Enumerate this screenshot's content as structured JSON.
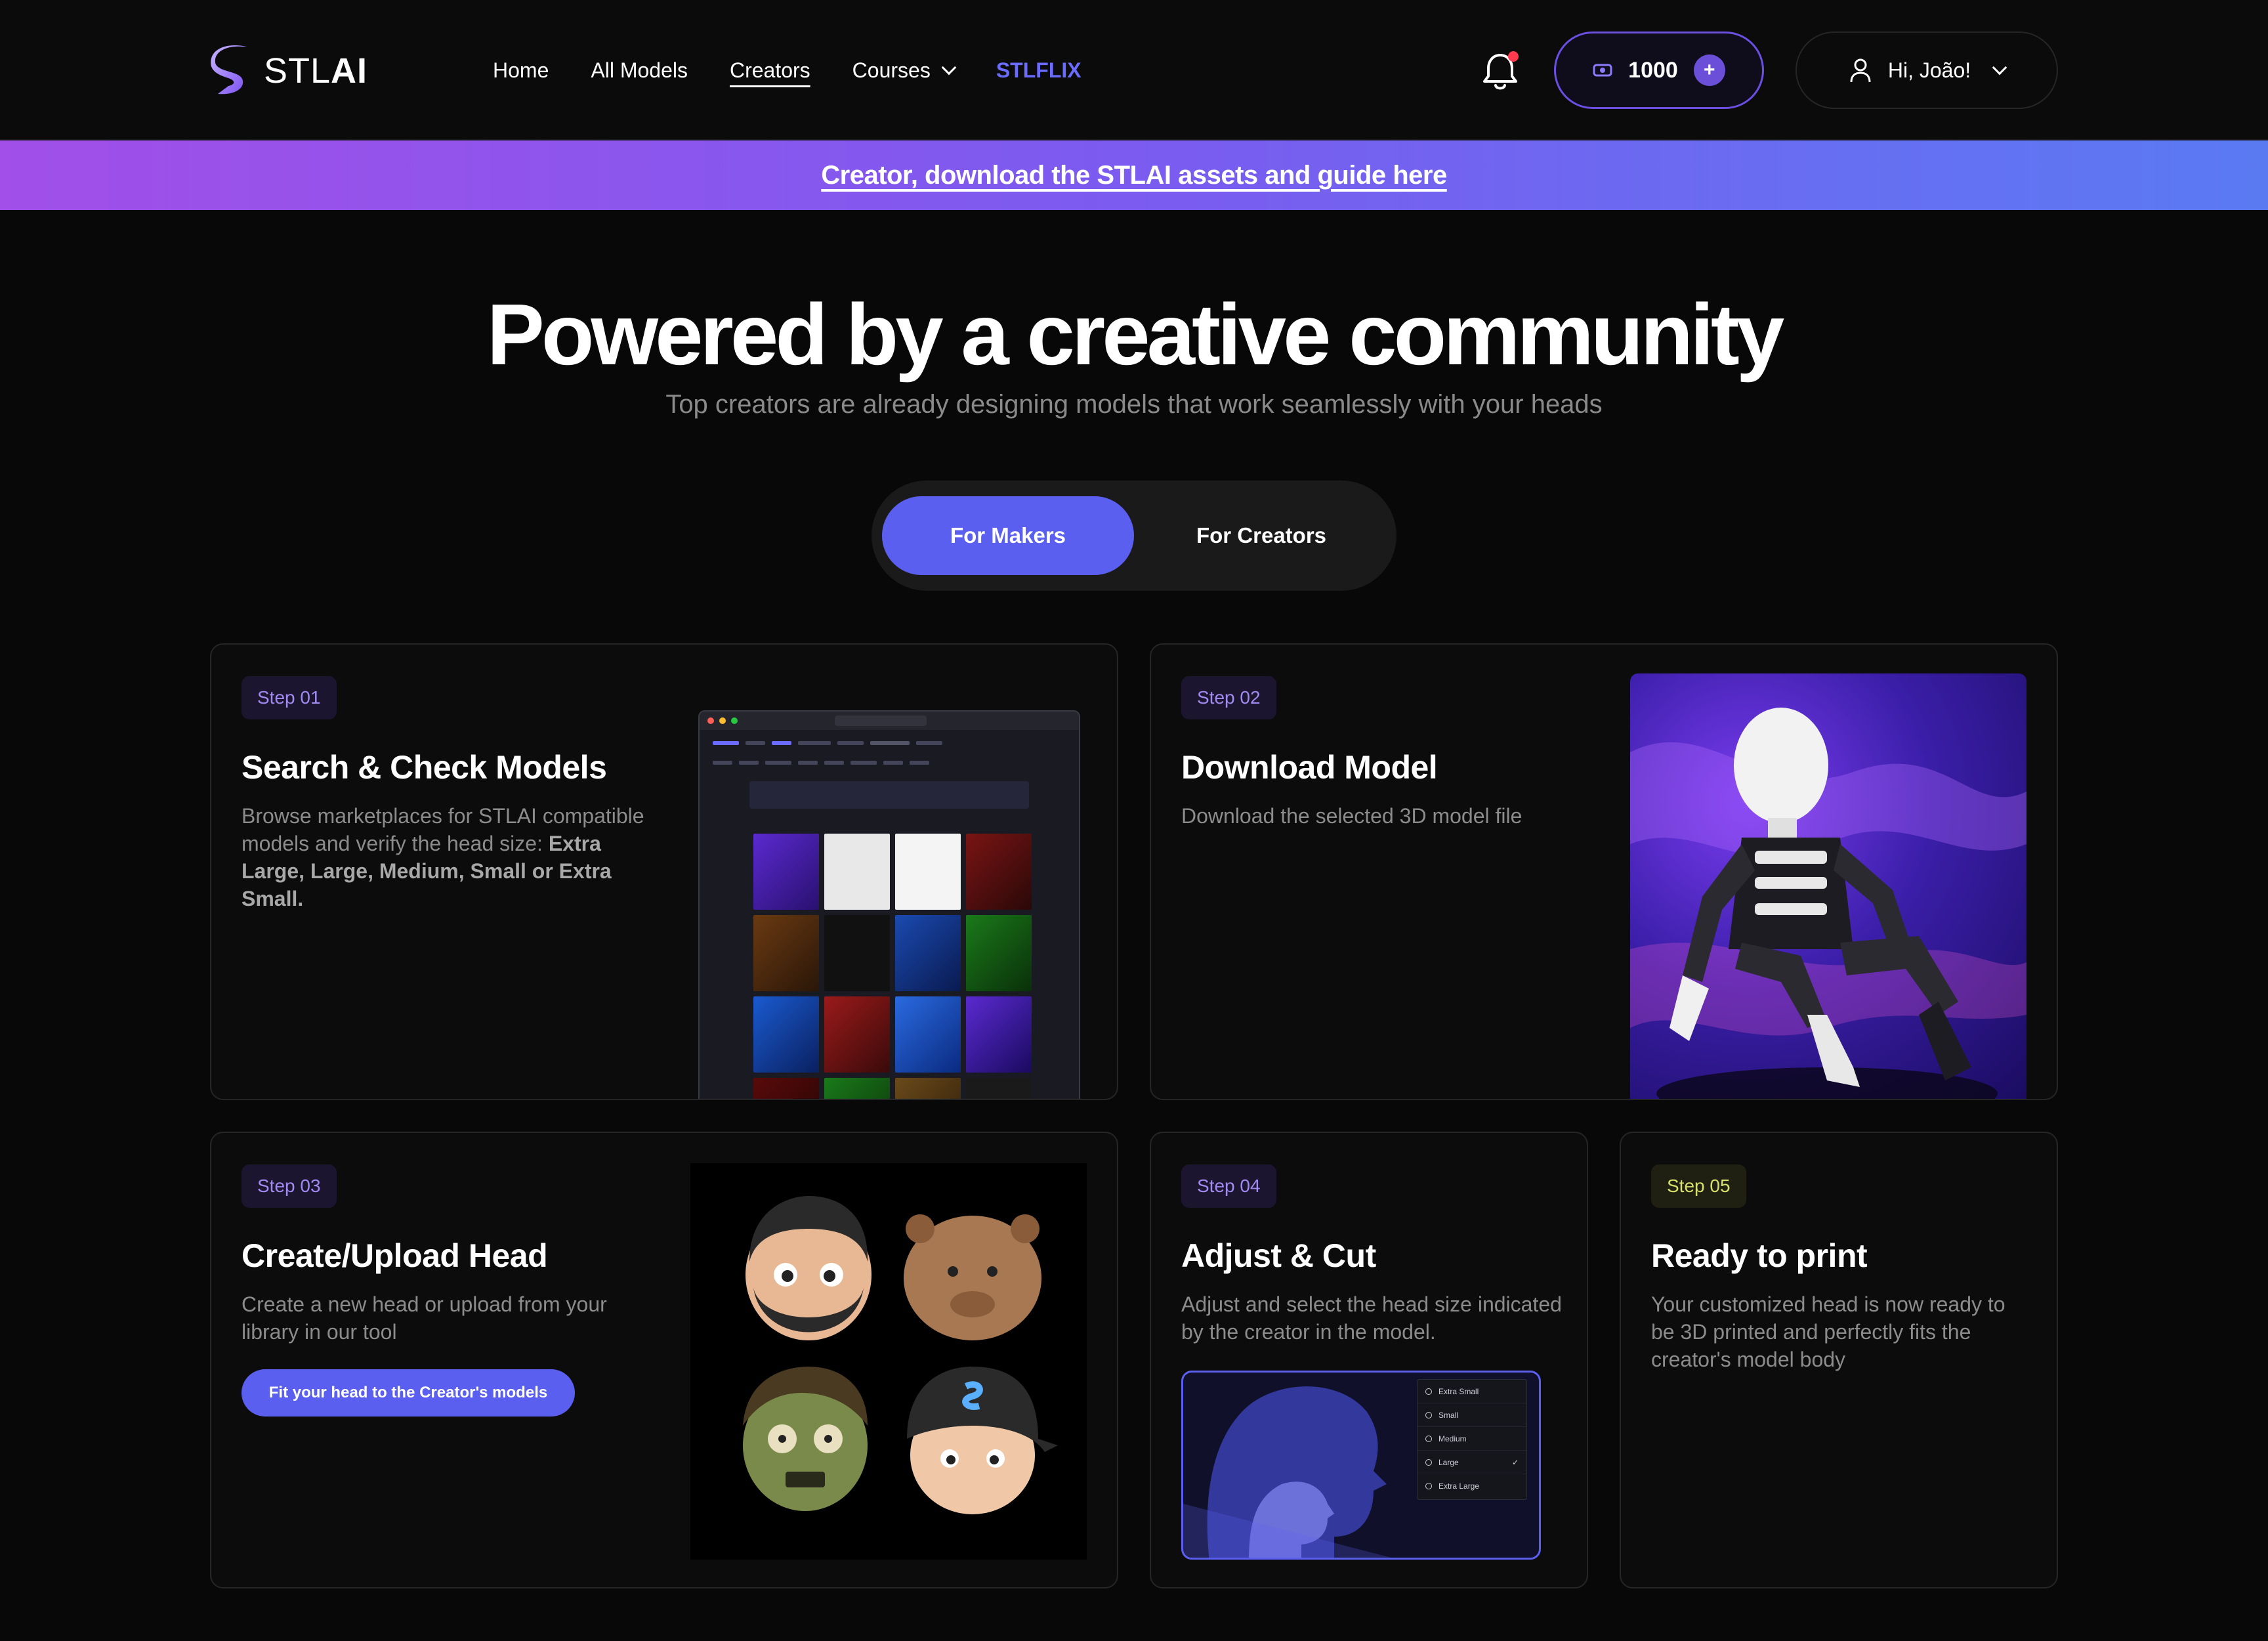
{
  "header": {
    "logo_text_light": "STL",
    "logo_text_bold": "AI",
    "nav": {
      "home": "Home",
      "all_models": "All Models",
      "creators": "Creators",
      "courses": "Courses",
      "stlflix": "STLFLIX"
    },
    "credits": "1000",
    "credits_plus": "+",
    "greeting": "Hi, João!"
  },
  "banner": {
    "link": "Creator, download the STLAI assets and guide here"
  },
  "hero": {
    "title": "Powered by a creative community",
    "subtitle": "Top creators are already designing models that work seamlessly with your heads"
  },
  "toggle": {
    "makers": "For Makers",
    "creators": "For Creators"
  },
  "steps": [
    {
      "badge": "Step 01",
      "title": "Search & Check Models",
      "desc_lead": "Browse marketplaces for STLAI compatible models and verify the head size: ",
      "desc_bold": "Extra Large, Large, Medium, Small or Extra Small."
    },
    {
      "badge": "Step 02",
      "title": "Download Model",
      "desc": "Download the selected 3D model file"
    },
    {
      "badge": "Step 03",
      "title": "Create/Upload Head",
      "desc": "Create a new head or upload from your library in our tool",
      "cta": "Fit your head to the Creator's models"
    },
    {
      "badge": "Step 04",
      "title": "Adjust & Cut",
      "desc": "Adjust and select the head size indicated by the creator in the model.",
      "sizes": [
        "Extra Small",
        "Small",
        "Medium",
        "Large",
        "Extra Large"
      ],
      "selected_mark": "✓"
    },
    {
      "badge": "Step 05",
      "title": "Ready to print",
      "desc": "Your customized head is now ready to be 3D printed and perfectly fits the creator's model body"
    }
  ],
  "colors": {
    "accent": "#5b5ff0",
    "banner_start": "#a14fe8",
    "banner_end": "#5a7af2",
    "background": "#080808"
  },
  "icons": [
    "logo-s-icon",
    "chevron-down-icon",
    "bell-icon",
    "coin-icon",
    "plus-icon",
    "user-icon",
    "check-icon"
  ]
}
